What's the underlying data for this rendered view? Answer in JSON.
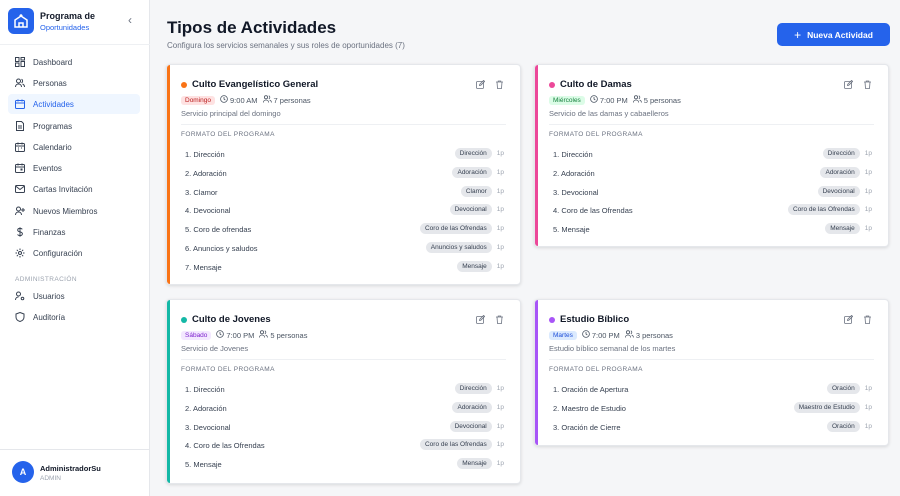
{
  "brand": {
    "title": "Programa de",
    "subtitle": "Oportunidades"
  },
  "nav": {
    "items": [
      {
        "label": "Dashboard",
        "icon": "dashboard-icon"
      },
      {
        "label": "Personas",
        "icon": "users-icon"
      },
      {
        "label": "Actividades",
        "icon": "calendar-icon",
        "active": true
      },
      {
        "label": "Programas",
        "icon": "document-icon"
      },
      {
        "label": "Calendario",
        "icon": "calendar-icon"
      },
      {
        "label": "Eventos",
        "icon": "event-icon"
      },
      {
        "label": "Cartas Invitación",
        "icon": "mail-icon"
      },
      {
        "label": "Nuevos Miembros",
        "icon": "user-plus-icon"
      },
      {
        "label": "Finanzas",
        "icon": "dollar-icon"
      },
      {
        "label": "Configuración",
        "icon": "gear-icon"
      }
    ],
    "admin_section": "ADMINISTRACIÓN",
    "admin_items": [
      {
        "label": "Usuarios",
        "icon": "user-gear-icon"
      },
      {
        "label": "Auditoría",
        "icon": "shield-icon"
      }
    ]
  },
  "user": {
    "initial": "A",
    "name": "AdministradorSu",
    "role": "ADMIN"
  },
  "header": {
    "title": "Tipos de Actividades",
    "subtitle": "Configura los servicios semanales y sus roles de oportunidades (7)",
    "new_button": "Nueva Actividad"
  },
  "colors": {
    "accent": "#2563eb"
  },
  "cards": [
    {
      "title": "Culto Evangelístico General",
      "color": "#f97316",
      "day": "Domingo",
      "day_bg": "#fee2e2",
      "day_fg": "#b91c1c",
      "time": "9:00 AM",
      "people": "7 personas",
      "description": "Servicio principal del domingo",
      "format_label": "FORMATO DEL PROGRAMA",
      "items": [
        {
          "num": "1.",
          "name": "Dirección",
          "role": "Dirección",
          "count": "1p"
        },
        {
          "num": "2.",
          "name": "Adoración",
          "role": "Adoración",
          "count": "1p"
        },
        {
          "num": "3.",
          "name": "Clamor",
          "role": "Clamor",
          "count": "1p"
        },
        {
          "num": "4.",
          "name": "Devocional",
          "role": "Devocional",
          "count": "1p"
        },
        {
          "num": "5.",
          "name": "Coro de ofrendas",
          "role": "Coro de las Ofrendas",
          "count": "1p"
        },
        {
          "num": "6.",
          "name": "Anuncios y saludos",
          "role": "Anuncios y saludos",
          "count": "1p"
        },
        {
          "num": "7.",
          "name": "Mensaje",
          "role": "Mensaje",
          "count": "1p"
        }
      ]
    },
    {
      "title": "Culto de Damas",
      "color": "#ec4899",
      "day": "Miércoles",
      "day_bg": "#dcfce7",
      "day_fg": "#15803d",
      "time": "7:00 PM",
      "people": "5 personas",
      "description": "Servicio de las damas y cabaelleros",
      "format_label": "FORMATO DEL PROGRAMA",
      "items": [
        {
          "num": "1.",
          "name": "Dirección",
          "role": "Dirección",
          "count": "1p"
        },
        {
          "num": "2.",
          "name": "Adoración",
          "role": "Adoración",
          "count": "1p"
        },
        {
          "num": "3.",
          "name": "Devocional",
          "role": "Devocional",
          "count": "1p"
        },
        {
          "num": "4.",
          "name": "Coro de las Ofrendas",
          "role": "Coro de las Ofrendas",
          "count": "1p"
        },
        {
          "num": "5.",
          "name": "Mensaje",
          "role": "Mensaje",
          "count": "1p"
        }
      ]
    },
    {
      "title": "Culto de Jovenes",
      "color": "#14b8a6",
      "day": "Sábado",
      "day_bg": "#f3e8ff",
      "day_fg": "#7e22ce",
      "time": "7:00 PM",
      "people": "5 personas",
      "description": "Servicio de Jovenes",
      "format_label": "FORMATO DEL PROGRAMA",
      "items": [
        {
          "num": "1.",
          "name": "Dirección",
          "role": "Dirección",
          "count": "1p"
        },
        {
          "num": "2.",
          "name": "Adoración",
          "role": "Adoración",
          "count": "1p"
        },
        {
          "num": "3.",
          "name": "Devocional",
          "role": "Devocional",
          "count": "1p"
        },
        {
          "num": "4.",
          "name": "Coro de las Ofrendas",
          "role": "Coro de las Ofrendas",
          "count": "1p"
        },
        {
          "num": "5.",
          "name": "Mensaje",
          "role": "Mensaje",
          "count": "1p"
        }
      ]
    },
    {
      "title": "Estudio Bíblico",
      "color": "#a855f7",
      "day": "Martes",
      "day_bg": "#dbeafe",
      "day_fg": "#1d4ed8",
      "time": "7:00 PM",
      "people": "3 personas",
      "description": "Estudio bíblico semanal de los martes",
      "format_label": "FORMATO DEL PROGRAMA",
      "items": [
        {
          "num": "1.",
          "name": "Oración de Apertura",
          "role": "Oración",
          "count": "1p"
        },
        {
          "num": "2.",
          "name": "Maestro de Estudio",
          "role": "Maestro de Estudio",
          "count": "1p"
        },
        {
          "num": "3.",
          "name": "Oración de Cierre",
          "role": "Oración",
          "count": "1p"
        }
      ]
    }
  ]
}
